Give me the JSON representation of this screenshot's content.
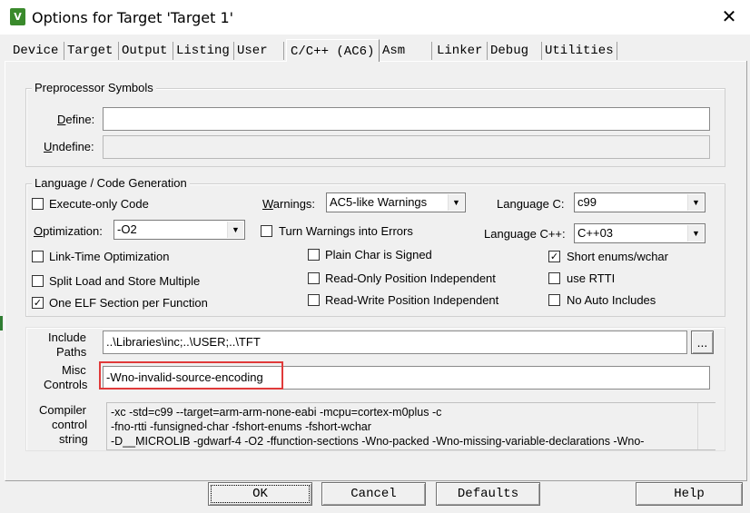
{
  "window": {
    "title": "Options for Target 'Target 1'",
    "icon": "keil-uvision-icon",
    "close_glyph": "✕"
  },
  "tabs": [
    {
      "label": "Device"
    },
    {
      "label": "Target"
    },
    {
      "label": "Output"
    },
    {
      "label": "Listing"
    },
    {
      "label": "User"
    },
    {
      "label": "C/C++ (AC6)",
      "active": true
    },
    {
      "label": "Asm"
    },
    {
      "label": "Linker"
    },
    {
      "label": "Debug"
    },
    {
      "label": "Utilities"
    }
  ],
  "preprocessor": {
    "group_label": "Preprocessor Symbols",
    "define_label": "Define:",
    "define_value": "",
    "undefine_label": "Undefine:",
    "undefine_value": ""
  },
  "language": {
    "group_label": "Language / Code Generation",
    "execute_only": {
      "label": "Execute-only Code",
      "checked": false
    },
    "warnings": {
      "label": "Warnings:",
      "value": "AC5-like Warnings"
    },
    "language_c": {
      "label": "Language C:",
      "value": "c99"
    },
    "optimization": {
      "label": "Optimization:",
      "value": "-O2"
    },
    "turn_warnings_errors": {
      "label": "Turn Warnings into Errors",
      "checked": false
    },
    "language_cpp": {
      "label": "Language C++:",
      "value": "C++03"
    },
    "link_time_opt": {
      "label": "Link-Time Optimization",
      "checked": false
    },
    "plain_char_signed": {
      "label": "Plain Char is Signed",
      "checked": false
    },
    "short_enums": {
      "label": "Short enums/wchar",
      "checked": true
    },
    "split_load_store": {
      "label": "Split Load and Store Multiple",
      "checked": false
    },
    "ro_position_indep": {
      "label": "Read-Only Position Independent",
      "checked": false
    },
    "use_rtti": {
      "label": "use RTTI",
      "checked": false
    },
    "one_elf_section": {
      "label": "One ELF Section per Function",
      "checked": true
    },
    "rw_position_indep": {
      "label": "Read-Write Position Independent",
      "checked": false
    },
    "no_auto_includes": {
      "label": "No Auto Includes",
      "checked": false
    }
  },
  "include": {
    "label_line1": "Include",
    "label_line2": "Paths",
    "value": "..\\Libraries\\inc;..\\USER;..\\TFT",
    "browse_label": "..."
  },
  "misc": {
    "label_line1": "Misc",
    "label_line2": "Controls",
    "value": "-Wno-invalid-source-encoding",
    "highlight_color": "#e03a3a"
  },
  "compiler": {
    "label_line1": "Compiler",
    "label_line2": "control",
    "label_line3": "string",
    "lines": [
      "-xc -std=c99 --target=arm-arm-none-eabi -mcpu=cortex-m0plus -c",
      "-fno-rtti -funsigned-char -fshort-enums -fshort-wchar",
      "-D__MICROLIB -gdwarf-4 -O2 -ffunction-sections -Wno-packed -Wno-missing-variable-declarations -Wno-"
    ]
  },
  "buttons": {
    "ok": "OK",
    "cancel": "Cancel",
    "defaults": "Defaults",
    "help": "Help"
  },
  "colors": {
    "check_mark": "✓",
    "dropdown_arrow": "▼"
  }
}
